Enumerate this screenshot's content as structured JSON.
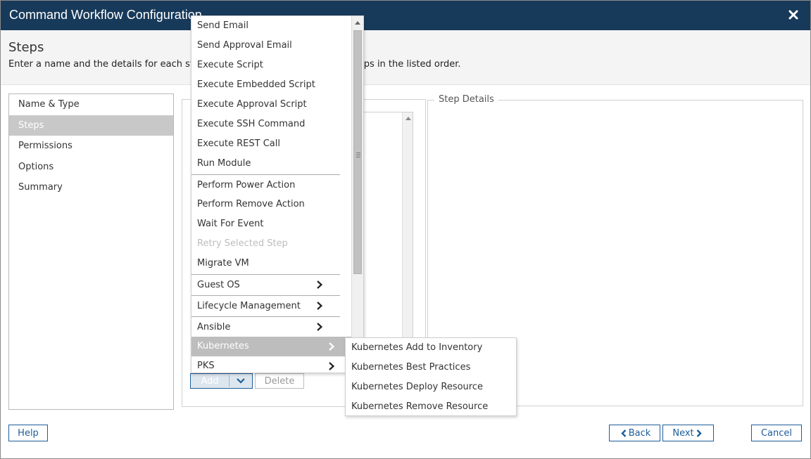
{
  "window": {
    "title": "Command Workflow Configuration"
  },
  "header": {
    "title": "Steps",
    "description": "Enter a name and the details for each step. The workflow will execute the steps in the listed order."
  },
  "nav": {
    "items": [
      {
        "label": "Name & Type",
        "active": false
      },
      {
        "label": "Steps",
        "active": true
      },
      {
        "label": "Permissions",
        "active": false
      },
      {
        "label": "Options",
        "active": false
      },
      {
        "label": "Summary",
        "active": false
      }
    ]
  },
  "details": {
    "legend": "Step Details"
  },
  "buttons": {
    "add": "Add",
    "delete": "Delete",
    "help": "Help",
    "back": "Back",
    "next": "Next",
    "cancel": "Cancel"
  },
  "menu": {
    "items": [
      {
        "label": "Send Email"
      },
      {
        "label": "Send Approval Email"
      },
      {
        "label": "Execute Script"
      },
      {
        "label": "Execute Embedded Script"
      },
      {
        "label": "Execute Approval Script"
      },
      {
        "label": "Execute SSH Command"
      },
      {
        "label": "Execute REST Call"
      },
      {
        "label": "Run Module"
      },
      {
        "label": "Perform Power Action"
      },
      {
        "label": "Perform Remove Action"
      },
      {
        "label": "Wait For Event"
      },
      {
        "label": "Retry Selected Step",
        "disabled": true
      },
      {
        "label": "Migrate VM"
      },
      {
        "label": "Guest OS",
        "submenu": true
      },
      {
        "label": "Lifecycle Management",
        "submenu": true
      },
      {
        "label": "Ansible",
        "submenu": true
      },
      {
        "label": "Kubernetes",
        "submenu": true,
        "highlighted": true
      },
      {
        "label": "PKS",
        "submenu": true
      }
    ]
  },
  "submenu": {
    "items": [
      {
        "label": "Kubernetes Add to Inventory"
      },
      {
        "label": "Kubernetes Best Practices"
      },
      {
        "label": "Kubernetes Deploy Resource"
      },
      {
        "label": "Kubernetes Remove Resource"
      }
    ]
  },
  "colors": {
    "titlebar": "#183a5a",
    "accent": "#1d5d99",
    "nav_active": "#c8c8c8",
    "menu_highlight": "#bdbdbd"
  }
}
